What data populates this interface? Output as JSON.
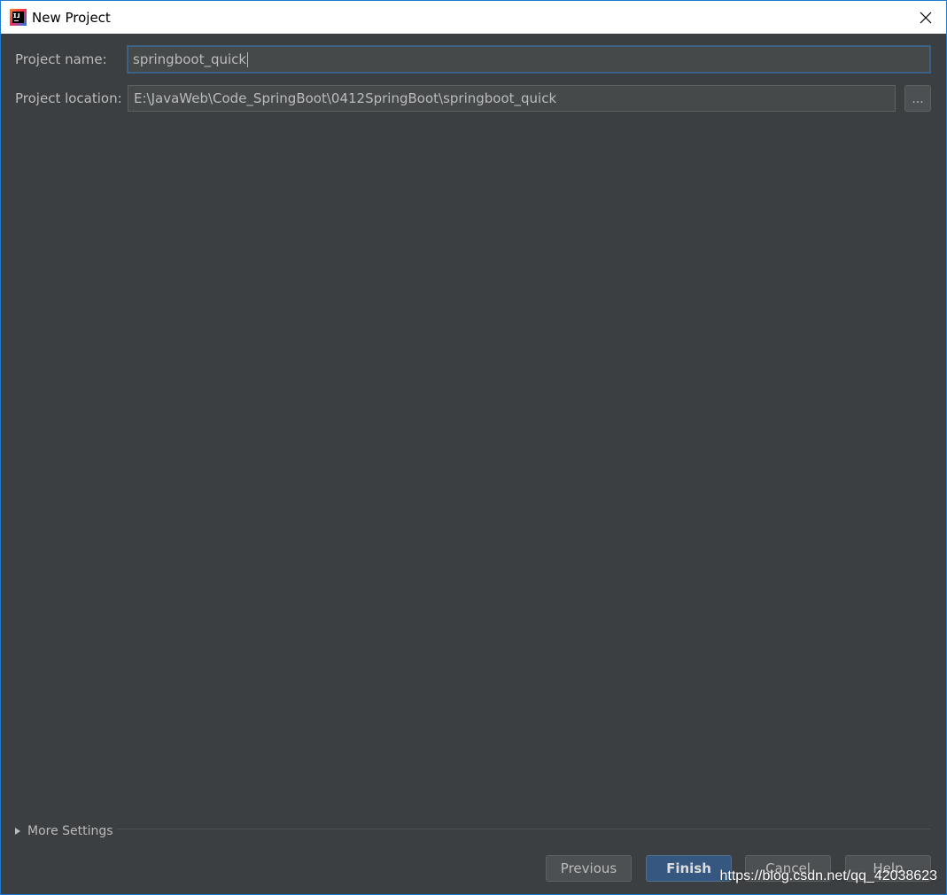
{
  "window": {
    "title": "New Project",
    "icon": "intellij-idea-icon",
    "close_icon": "close-icon"
  },
  "form": {
    "project_name_label": "Project name:",
    "project_name_value": "springboot_quick",
    "project_location_label": "Project location:",
    "project_location_value": "E:\\JavaWeb\\Code_SpringBoot\\0412SpringBoot\\springboot_quick",
    "browse_label": "..."
  },
  "more_settings": {
    "label": "More Settings",
    "icon": "triangle-right-icon"
  },
  "buttons": {
    "previous": "Previous",
    "finish": "Finish",
    "cancel": "Cancel",
    "help": "Help"
  },
  "watermark": "https://blog.csdn.net/qq_42038623",
  "colors": {
    "background": "#3c3f41",
    "input_bg": "#45494a",
    "text": "#bbbbbb",
    "focus_border": "#3d6185",
    "primary_button": "#365880",
    "window_border": "#1f7acb"
  }
}
